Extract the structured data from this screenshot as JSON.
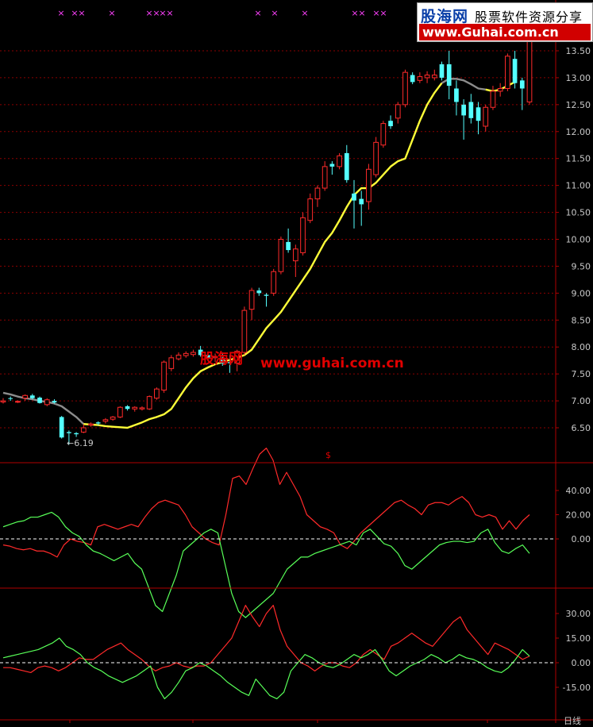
{
  "watermark": {
    "logo_text": "股海网",
    "slogan": "股票软件资源分享",
    "url": "www.Guhai.com.cn",
    "overlay_logo": "股海网",
    "overlay_url": "www.guhai.com.cn"
  },
  "main_panel": {
    "low_label": "←6.19",
    "indicator_marker": "$",
    "period_label": "日线",
    "price_ticks": [
      "13.50",
      "13.00",
      "12.50",
      "12.00",
      "11.50",
      "11.00",
      "10.50",
      "10.00",
      "9.50",
      "9.00",
      "8.50",
      "8.00",
      "7.50",
      "7.00",
      "6.50"
    ],
    "colors": {
      "up": "#ff2a2a",
      "down": "#54ffff",
      "ma_yellow": "#ffff38",
      "ma_gray": "#8c8c8c",
      "grid": "#8b0000",
      "border": "#b00000"
    }
  },
  "signal_marks": [
    {
      "x": 77
    },
    {
      "x": 94
    },
    {
      "x": 103
    },
    {
      "x": 141
    },
    {
      "x": 188
    },
    {
      "x": 197
    },
    {
      "x": 205
    },
    {
      "x": 214
    },
    {
      "x": 325
    },
    {
      "x": 346
    },
    {
      "x": 384
    },
    {
      "x": 447
    },
    {
      "x": 456
    },
    {
      "x": 474
    },
    {
      "x": 483
    }
  ],
  "chart_data": [
    {
      "type": "candlestick",
      "ylim": [
        6.1,
        13.9
      ],
      "candles": [
        {
          "o": 7.0,
          "h": 7.05,
          "l": 6.95,
          "c": 6.98,
          "up": true
        },
        {
          "o": 7.05,
          "h": 7.08,
          "l": 7.0,
          "c": 7.05,
          "up": false
        },
        {
          "o": 6.98,
          "h": 7.01,
          "l": 6.96,
          "c": 6.99,
          "up": true
        },
        {
          "o": 7.05,
          "h": 7.12,
          "l": 7.0,
          "c": 7.1,
          "up": true
        },
        {
          "o": 7.1,
          "h": 7.13,
          "l": 7.03,
          "c": 7.05,
          "up": false
        },
        {
          "o": 7.06,
          "h": 7.08,
          "l": 6.95,
          "c": 6.96,
          "up": false
        },
        {
          "o": 6.93,
          "h": 7.05,
          "l": 6.9,
          "c": 7.02,
          "up": true
        },
        {
          "o": 7.0,
          "h": 7.03,
          "l": 6.95,
          "c": 6.97,
          "up": false
        },
        {
          "o": 6.7,
          "h": 6.72,
          "l": 6.3,
          "c": 6.32,
          "up": false
        },
        {
          "o": 6.42,
          "h": 6.45,
          "l": 6.19,
          "c": 6.4,
          "up": false
        },
        {
          "o": 6.38,
          "h": 6.42,
          "l": 6.33,
          "c": 6.4,
          "up": false
        },
        {
          "o": 6.42,
          "h": 6.56,
          "l": 6.4,
          "c": 6.5,
          "up": true
        },
        {
          "o": 6.55,
          "h": 6.6,
          "l": 6.52,
          "c": 6.57,
          "up": true
        },
        {
          "o": 6.58,
          "h": 6.62,
          "l": 6.55,
          "c": 6.6,
          "up": false
        },
        {
          "o": 6.62,
          "h": 6.68,
          "l": 6.58,
          "c": 6.65,
          "up": true
        },
        {
          "o": 6.66,
          "h": 6.72,
          "l": 6.63,
          "c": 6.7,
          "up": true
        },
        {
          "o": 6.7,
          "h": 6.9,
          "l": 6.68,
          "c": 6.88,
          "up": true
        },
        {
          "o": 6.85,
          "h": 6.92,
          "l": 6.82,
          "c": 6.9,
          "up": false
        },
        {
          "o": 6.85,
          "h": 6.9,
          "l": 6.8,
          "c": 6.88,
          "up": true
        },
        {
          "o": 6.85,
          "h": 6.9,
          "l": 6.82,
          "c": 6.87,
          "up": true
        },
        {
          "o": 6.85,
          "h": 7.1,
          "l": 6.83,
          "c": 7.08,
          "up": true
        },
        {
          "o": 7.05,
          "h": 7.25,
          "l": 7.02,
          "c": 7.22,
          "up": true
        },
        {
          "o": 7.2,
          "h": 7.75,
          "l": 7.15,
          "c": 7.72,
          "up": true
        },
        {
          "o": 7.6,
          "h": 7.85,
          "l": 7.55,
          "c": 7.8,
          "up": true
        },
        {
          "o": 7.78,
          "h": 7.9,
          "l": 7.75,
          "c": 7.85,
          "up": true
        },
        {
          "o": 7.84,
          "h": 7.92,
          "l": 7.8,
          "c": 7.88,
          "up": true
        },
        {
          "o": 7.86,
          "h": 7.95,
          "l": 7.82,
          "c": 7.9,
          "up": true
        },
        {
          "o": 7.95,
          "h": 8.02,
          "l": 7.82,
          "c": 7.85,
          "up": false
        },
        {
          "o": 7.85,
          "h": 7.88,
          "l": 7.75,
          "c": 7.78,
          "up": false
        },
        {
          "o": 7.8,
          "h": 7.88,
          "l": 7.72,
          "c": 7.82,
          "up": true
        },
        {
          "o": 7.8,
          "h": 7.9,
          "l": 7.65,
          "c": 7.7,
          "up": false
        },
        {
          "o": 7.7,
          "h": 7.85,
          "l": 7.52,
          "c": 7.72,
          "up": false
        },
        {
          "o": 7.7,
          "h": 7.95,
          "l": 7.55,
          "c": 7.92,
          "up": true
        },
        {
          "o": 7.9,
          "h": 8.75,
          "l": 7.85,
          "c": 8.68,
          "up": true
        },
        {
          "o": 8.7,
          "h": 9.1,
          "l": 8.5,
          "c": 9.05,
          "up": true
        },
        {
          "o": 9.05,
          "h": 9.1,
          "l": 8.95,
          "c": 9.0,
          "up": false
        },
        {
          "o": 8.95,
          "h": 9.0,
          "l": 8.75,
          "c": 8.97,
          "up": false
        },
        {
          "o": 9.0,
          "h": 9.45,
          "l": 8.95,
          "c": 9.4,
          "up": true
        },
        {
          "o": 9.4,
          "h": 10.05,
          "l": 9.35,
          "c": 10.0,
          "up": true
        },
        {
          "o": 9.95,
          "h": 10.2,
          "l": 9.75,
          "c": 9.8,
          "up": false
        },
        {
          "o": 9.6,
          "h": 9.9,
          "l": 9.3,
          "c": 9.82,
          "up": true
        },
        {
          "o": 9.75,
          "h": 10.5,
          "l": 9.7,
          "c": 10.4,
          "up": true
        },
        {
          "o": 10.35,
          "h": 10.85,
          "l": 10.3,
          "c": 10.75,
          "up": true
        },
        {
          "o": 10.75,
          "h": 11.0,
          "l": 10.6,
          "c": 10.95,
          "up": true
        },
        {
          "o": 10.95,
          "h": 11.45,
          "l": 10.9,
          "c": 11.35,
          "up": true
        },
        {
          "o": 11.35,
          "h": 11.45,
          "l": 11.2,
          "c": 11.4,
          "up": false
        },
        {
          "o": 11.35,
          "h": 11.6,
          "l": 11.3,
          "c": 11.55,
          "up": true
        },
        {
          "o": 11.6,
          "h": 11.75,
          "l": 11.05,
          "c": 11.1,
          "up": false
        },
        {
          "o": 10.85,
          "h": 11.1,
          "l": 10.2,
          "c": 10.72,
          "up": false
        },
        {
          "o": 10.75,
          "h": 10.9,
          "l": 10.25,
          "c": 10.65,
          "up": false
        },
        {
          "o": 10.7,
          "h": 11.4,
          "l": 10.55,
          "c": 11.3,
          "up": true
        },
        {
          "o": 11.2,
          "h": 11.9,
          "l": 11.15,
          "c": 11.8,
          "up": true
        },
        {
          "o": 11.75,
          "h": 12.2,
          "l": 11.7,
          "c": 12.15,
          "up": true
        },
        {
          "o": 12.1,
          "h": 12.3,
          "l": 12.05,
          "c": 12.2,
          "up": false
        },
        {
          "o": 12.25,
          "h": 12.55,
          "l": 12.15,
          "c": 12.5,
          "up": true
        },
        {
          "o": 12.5,
          "h": 13.15,
          "l": 12.45,
          "c": 13.1,
          "up": true
        },
        {
          "o": 13.05,
          "h": 13.1,
          "l": 12.88,
          "c": 12.92,
          "up": false
        },
        {
          "o": 12.95,
          "h": 13.1,
          "l": 12.9,
          "c": 13.02,
          "up": true
        },
        {
          "o": 13.0,
          "h": 13.12,
          "l": 12.9,
          "c": 13.05,
          "up": true
        },
        {
          "o": 13.05,
          "h": 13.15,
          "l": 12.95,
          "c": 13.0,
          "up": true
        },
        {
          "o": 13.0,
          "h": 13.3,
          "l": 12.95,
          "c": 13.25,
          "up": false
        },
        {
          "o": 13.25,
          "h": 13.5,
          "l": 12.6,
          "c": 12.85,
          "up": false
        },
        {
          "o": 12.8,
          "h": 12.95,
          "l": 12.3,
          "c": 12.55,
          "up": false
        },
        {
          "o": 12.5,
          "h": 12.6,
          "l": 11.85,
          "c": 12.3,
          "up": false
        },
        {
          "o": 12.25,
          "h": 12.7,
          "l": 12.15,
          "c": 12.55,
          "up": false
        },
        {
          "o": 12.45,
          "h": 12.55,
          "l": 11.95,
          "c": 12.2,
          "up": false
        },
        {
          "o": 12.1,
          "h": 12.5,
          "l": 12.0,
          "c": 12.45,
          "up": true
        },
        {
          "o": 12.45,
          "h": 12.85,
          "l": 12.4,
          "c": 12.75,
          "up": true
        },
        {
          "o": 12.75,
          "h": 12.9,
          "l": 12.65,
          "c": 12.8,
          "up": true
        },
        {
          "o": 12.8,
          "h": 13.45,
          "l": 12.75,
          "c": 13.4,
          "up": true
        },
        {
          "o": 13.35,
          "h": 13.5,
          "l": 12.8,
          "c": 12.9,
          "up": false
        },
        {
          "o": 12.95,
          "h": 13.0,
          "l": 12.4,
          "c": 12.8,
          "up": false
        },
        {
          "o": 12.55,
          "h": 13.85,
          "l": 12.5,
          "c": 13.8,
          "up": true
        }
      ],
      "moving_average": [
        7.15,
        7.12,
        7.08,
        7.05,
        7.03,
        7.0,
        6.98,
        6.95,
        6.9,
        6.8,
        6.7,
        6.57,
        6.56,
        6.55,
        6.53,
        6.52,
        6.51,
        6.5,
        6.55,
        6.6,
        6.66,
        6.7,
        6.75,
        6.85,
        7.05,
        7.25,
        7.42,
        7.55,
        7.62,
        7.68,
        7.72,
        7.76,
        7.8,
        7.85,
        7.95,
        8.15,
        8.35,
        8.5,
        8.65,
        8.85,
        9.05,
        9.25,
        9.45,
        9.7,
        9.95,
        10.12,
        10.35,
        10.6,
        10.82,
        10.95,
        10.95,
        11.05,
        11.2,
        11.35,
        11.45,
        11.5,
        11.85,
        12.2,
        12.5,
        12.72,
        12.9,
        12.98,
        12.98,
        12.95,
        12.88,
        12.8,
        12.78,
        12.75,
        12.78,
        12.85,
        12.92
      ]
    },
    {
      "type": "line",
      "ylim": [
        -80,
        60
      ],
      "ticks": [
        "40.00",
        "20.00",
        "0.00"
      ],
      "series": [
        {
          "color": "#ff2a2a",
          "values": [
            -5,
            -6,
            -8,
            -9,
            -8,
            -10,
            -10,
            -12,
            -15,
            -5,
            0,
            -2,
            -3,
            -5,
            10,
            12,
            10,
            8,
            10,
            12,
            10,
            18,
            25,
            30,
            32,
            30,
            28,
            20,
            10,
            5,
            0,
            -3,
            -5,
            20,
            50,
            52,
            45,
            58,
            70,
            75,
            65,
            45,
            55,
            45,
            35,
            20,
            15,
            10,
            8,
            5,
            -5,
            -8,
            -2,
            5,
            10,
            15,
            20,
            25,
            30,
            32,
            28,
            25,
            20,
            28,
            30,
            30,
            28,
            32,
            35,
            30,
            20,
            18,
            20,
            18,
            8,
            15,
            8,
            15,
            20
          ]
        },
        {
          "color": "#58ff58",
          "values": [
            10,
            12,
            14,
            15,
            18,
            18,
            20,
            22,
            18,
            10,
            5,
            2,
            -5,
            -10,
            -12,
            -15,
            -18,
            -15,
            -12,
            -20,
            -25,
            -40,
            -55,
            -60,
            -45,
            -30,
            -10,
            -5,
            0,
            5,
            8,
            5,
            -20,
            -45,
            -60,
            -65,
            -60,
            -55,
            -50,
            -45,
            -35,
            -25,
            -20,
            -15,
            -15,
            -12,
            -10,
            -8,
            -6,
            -4,
            -2,
            -5,
            5,
            8,
            2,
            -4,
            -6,
            -12,
            -22,
            -25,
            -20,
            -15,
            -10,
            -5,
            -3,
            -2,
            -2,
            -3,
            -2,
            5,
            8,
            -3,
            -10,
            -12,
            -8,
            -5,
            -12
          ]
        },
        {
          "color": "#ffffff",
          "dashed": true,
          "values": [
            0
          ]
        }
      ]
    },
    {
      "type": "line",
      "ylim": [
        -25,
        40
      ],
      "ticks": [
        "30.00",
        "15.00",
        "0.00",
        "-15.00"
      ],
      "series": [
        {
          "color": "#ff2a2a",
          "values": [
            -3,
            -3,
            -4,
            -5,
            -6,
            -3,
            -2,
            -3,
            -5,
            -3,
            0,
            3,
            2,
            2,
            5,
            8,
            10,
            12,
            8,
            5,
            2,
            -2,
            -5,
            -3,
            -2,
            0,
            -2,
            -3,
            -2,
            -2,
            0,
            5,
            10,
            15,
            25,
            35,
            28,
            22,
            30,
            35,
            20,
            10,
            5,
            0,
            -2,
            -5,
            -2,
            0,
            0,
            -2,
            -3,
            0,
            5,
            8,
            5,
            2,
            10,
            12,
            15,
            18,
            15,
            12,
            10,
            15,
            20,
            25,
            28,
            20,
            15,
            10,
            5,
            12,
            10,
            8,
            5,
            2,
            4
          ]
        },
        {
          "color": "#58ff58",
          "values": [
            3,
            4,
            5,
            6,
            7,
            8,
            10,
            12,
            15,
            10,
            8,
            5,
            0,
            -3,
            -5,
            -8,
            -10,
            -12,
            -10,
            -8,
            -5,
            -2,
            -15,
            -22,
            -18,
            -12,
            -5,
            -3,
            0,
            -2,
            -5,
            -8,
            -12,
            -15,
            -18,
            -20,
            -10,
            -15,
            -20,
            -22,
            -18,
            -5,
            0,
            5,
            3,
            0,
            -2,
            -3,
            -1,
            2,
            5,
            3,
            5,
            8,
            2,
            -5,
            -8,
            -5,
            -2,
            0,
            2,
            5,
            3,
            0,
            2,
            5,
            3,
            2,
            0,
            -3,
            -5,
            -6,
            -3,
            2,
            8,
            4
          ]
        },
        {
          "color": "#ffffff",
          "dashed": true,
          "values": [
            0
          ]
        }
      ]
    }
  ]
}
